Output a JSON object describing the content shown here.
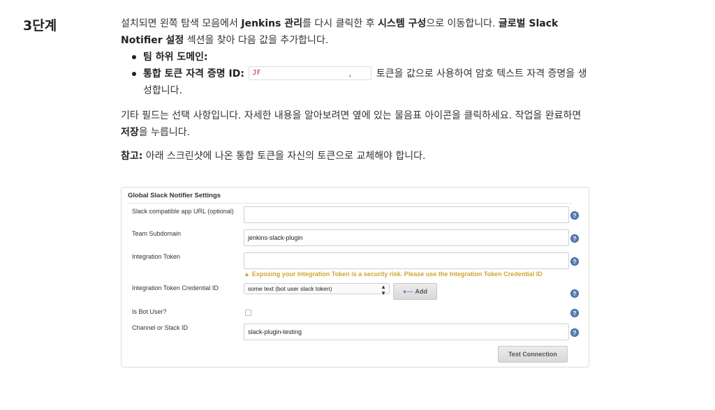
{
  "step": "3단계",
  "intro": {
    "t1": "설치되면 왼쪽 탐색 모음에서 ",
    "b1": "Jenkins 관리",
    "t2": "를 다시 클릭한 후 ",
    "b2": "시스템 구성",
    "t3": "으로 이동합니다. ",
    "b3": "글로벌 Slack Notifier 설정",
    "t4": " 섹션을 찾아 다음 값을 추가합니다."
  },
  "bullets": {
    "subdomain_label": "팀 하위 도메인:",
    "token_label": "통합 토큰 자격 증명 ID:",
    "token_value": "JF",
    "token_tick": ",",
    "token_rest": " 토큰을 값으로 사용하여 암호 텍스트 자격 증명을 생성합니다."
  },
  "para2": {
    "t1": "기타 필드는 선택 사항입니다. 자세한 내용을 알아보려면 옆에 있는 물음표 아이콘을 클릭하세요. 작업을 완료하면 ",
    "b1": "저장",
    "t2": "을 누릅니다."
  },
  "note": {
    "b1": "참고:",
    "t1": " 아래 스크린샷에 나온 통합 토큰을 자신의 토큰으로 교체해야 합니다."
  },
  "panel": {
    "title": "Global Slack Notifier Settings",
    "url_label": "Slack compatible app URL (optional)",
    "url_value": "",
    "subdomain_label": "Team Subdomain",
    "subdomain_value": "jenkins-slack-plugin",
    "token_label": "Integration Token",
    "token_value": "",
    "warning": "Exposing your Integration Token is a security risk. Please use the Integration Token Credential ID",
    "cred_label": "Integration Token Credential ID",
    "cred_selected": "some text (bot user slack token)",
    "add_label": "Add",
    "bot_label": "Is Bot User?",
    "channel_label": "Channel or Slack ID",
    "channel_value": "slack-plugin-testing",
    "test_label": "Test Connection",
    "help_glyph": "?"
  }
}
